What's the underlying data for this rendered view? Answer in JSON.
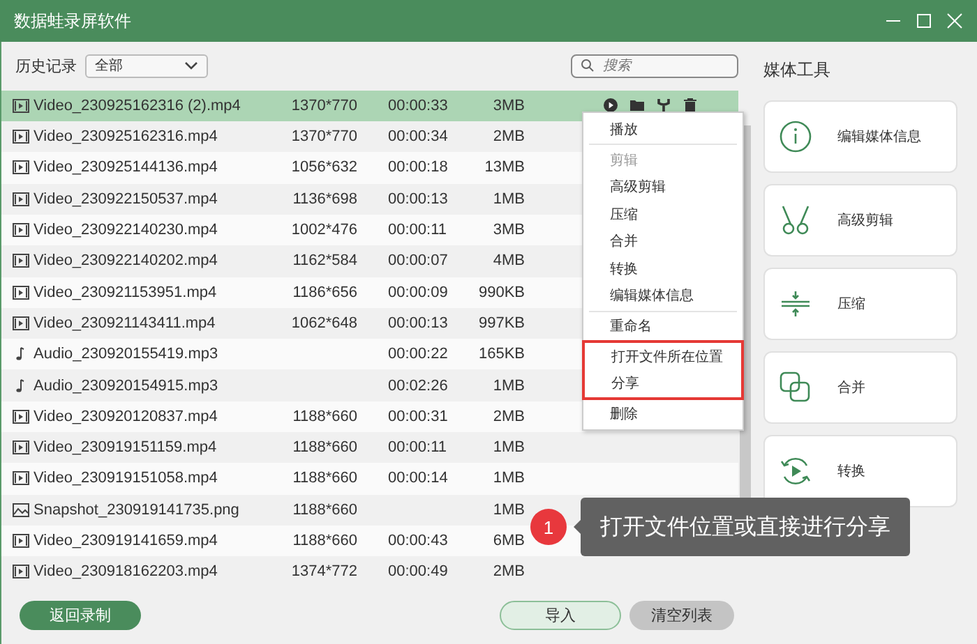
{
  "window": {
    "title": "数据蛙录屏软件"
  },
  "history": {
    "label": "历史记录",
    "filter": "全部",
    "search_placeholder": "搜索"
  },
  "files": [
    {
      "kind": "video",
      "name": "Video_230925162316 (2).mp4",
      "resolution": "1370*770",
      "duration": "00:00:33",
      "size": "3MB",
      "selected": true
    },
    {
      "kind": "video",
      "name": "Video_230925162316.mp4",
      "resolution": "1370*770",
      "duration": "00:00:34",
      "size": "2MB",
      "selected": false
    },
    {
      "kind": "video",
      "name": "Video_230925144136.mp4",
      "resolution": "1056*632",
      "duration": "00:00:18",
      "size": "13MB",
      "selected": false
    },
    {
      "kind": "video",
      "name": "Video_230922150537.mp4",
      "resolution": "1136*698",
      "duration": "00:00:13",
      "size": "1MB",
      "selected": false
    },
    {
      "kind": "video",
      "name": "Video_230922140230.mp4",
      "resolution": "1002*476",
      "duration": "00:00:11",
      "size": "3MB",
      "selected": false
    },
    {
      "kind": "video",
      "name": "Video_230922140202.mp4",
      "resolution": "1162*584",
      "duration": "00:00:07",
      "size": "4MB",
      "selected": false
    },
    {
      "kind": "video",
      "name": "Video_230921153951.mp4",
      "resolution": "1186*656",
      "duration": "00:00:09",
      "size": "990KB",
      "selected": false
    },
    {
      "kind": "video",
      "name": "Video_230921143411.mp4",
      "resolution": "1062*648",
      "duration": "00:00:13",
      "size": "997KB",
      "selected": false
    },
    {
      "kind": "audio",
      "name": "Audio_230920155419.mp3",
      "duration": "00:00:22",
      "size": "165KB",
      "selected": false
    },
    {
      "kind": "audio",
      "name": "Audio_230920154915.mp3",
      "duration": "00:02:26",
      "size": "1MB",
      "selected": false
    },
    {
      "kind": "video",
      "name": "Video_230920120837.mp4",
      "resolution": "1188*660",
      "duration": "00:00:31",
      "size": "2MB",
      "selected": false
    },
    {
      "kind": "video",
      "name": "Video_230919151159.mp4",
      "resolution": "1188*660",
      "duration": "00:00:11",
      "size": "1MB",
      "selected": false
    },
    {
      "kind": "video",
      "name": "Video_230919151058.mp4",
      "resolution": "1188*660",
      "duration": "00:00:14",
      "size": "1MB",
      "selected": false
    },
    {
      "kind": "image",
      "name": "Snapshot_230919141735.png",
      "resolution": "1188*660",
      "size": "1MB",
      "selected": false
    },
    {
      "kind": "video",
      "name": "Video_230919141659.mp4",
      "resolution": "1188*660",
      "duration": "00:00:43",
      "size": "6MB",
      "selected": false
    },
    {
      "kind": "video",
      "name": "Video_230918162203.mp4",
      "resolution": "1374*772",
      "duration": "00:00:49",
      "size": "2MB",
      "selected": false
    }
  ],
  "context_menu": [
    {
      "kind": "item",
      "label": "播放",
      "disabled": false,
      "highlighted": false
    },
    {
      "kind": "separator"
    },
    {
      "kind": "item",
      "label": "剪辑",
      "disabled": true,
      "highlighted": false
    },
    {
      "kind": "item",
      "label": "高级剪辑",
      "disabled": false,
      "highlighted": false
    },
    {
      "kind": "item",
      "label": "压缩",
      "disabled": false,
      "highlighted": false
    },
    {
      "kind": "item",
      "label": "合并",
      "disabled": false,
      "highlighted": false
    },
    {
      "kind": "item",
      "label": "转换",
      "disabled": false,
      "highlighted": false
    },
    {
      "kind": "item",
      "label": "编辑媒体信息",
      "disabled": false,
      "highlighted": false
    },
    {
      "kind": "separator"
    },
    {
      "kind": "item",
      "label": "重命名",
      "disabled": false,
      "highlighted": false
    },
    {
      "kind": "item",
      "label": "打开文件所在位置",
      "disabled": false,
      "highlighted": true
    },
    {
      "kind": "item",
      "label": "分享",
      "disabled": false,
      "highlighted": true
    },
    {
      "kind": "item",
      "label": "删除",
      "disabled": false,
      "highlighted": false
    }
  ],
  "callout": {
    "number": "1",
    "text": "打开文件位置或直接进行分享"
  },
  "buttons": {
    "back": "返回录制",
    "import": "导入",
    "clear": "清空列表"
  },
  "media_tools": {
    "title": "媒体工具",
    "tools": [
      {
        "kind": "info",
        "label": "编辑媒体信息"
      },
      {
        "kind": "cut",
        "label": "高级剪辑"
      },
      {
        "kind": "compress",
        "label": "压缩"
      },
      {
        "kind": "merge",
        "label": "合并"
      },
      {
        "kind": "convert",
        "label": "转换"
      }
    ]
  }
}
